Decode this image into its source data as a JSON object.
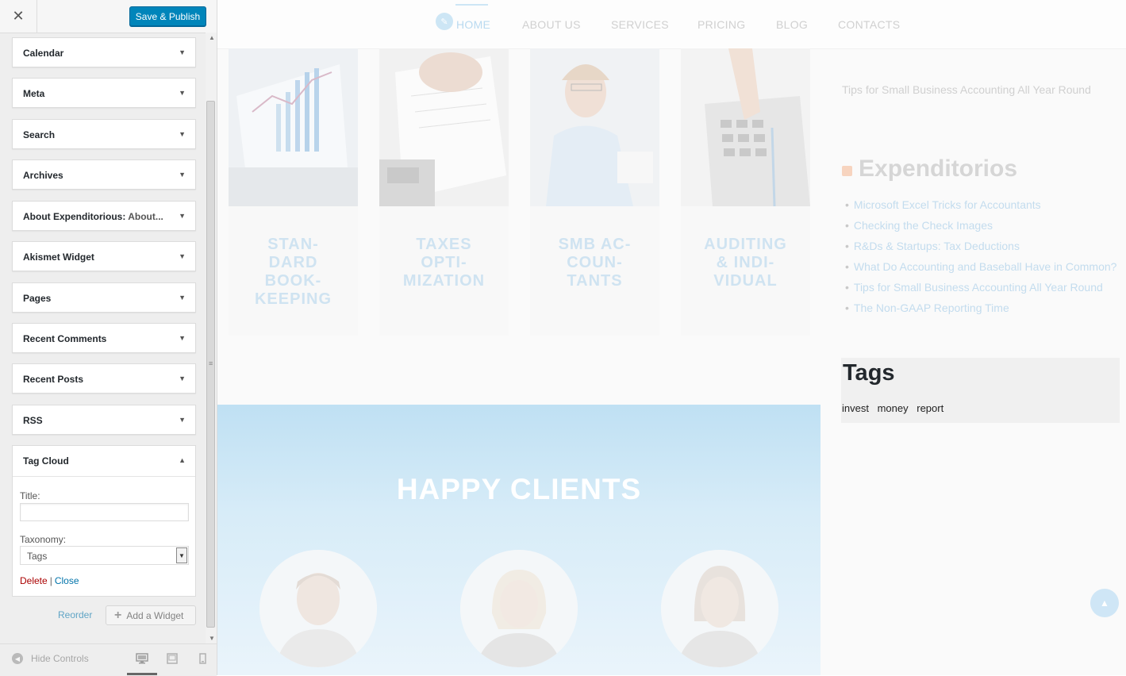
{
  "customizer": {
    "close_label": "✕",
    "publish_label": "Save & Publish",
    "widgets": [
      {
        "title": "Calendar"
      },
      {
        "title": "Meta"
      },
      {
        "title": "Search"
      },
      {
        "title": "Archives"
      },
      {
        "title": "About Expenditorious:",
        "subtitle": "About..."
      },
      {
        "title": "Akismet Widget"
      },
      {
        "title": "Pages"
      },
      {
        "title": "Recent Comments"
      },
      {
        "title": "Recent Posts"
      },
      {
        "title": "RSS"
      }
    ],
    "tag_cloud": {
      "title": "Tag Cloud",
      "title_label": "Title:",
      "title_value": "",
      "taxonomy_label": "Taxonomy:",
      "taxonomy_value": "Tags",
      "delete_label": "Delete",
      "separator": "|",
      "close_label": "Close"
    },
    "reorder_label": "Reorder",
    "add_widget_label": "Add a Widget",
    "hide_controls_label": "Hide Controls"
  },
  "preview": {
    "nav": [
      "HOME",
      "ABOUT US",
      "SERVICES",
      "PRICING",
      "BLOG",
      "CONTACTS"
    ],
    "services": [
      "STAN-\nDARD\nBOOK-\nKEEPING",
      "TAXES\nOPTI-\nMIZATION",
      "SMB AC-\nCOUN-\nTANTS",
      "AUDITING\n& INDI-\nVIDUAL"
    ],
    "sidebar_top_link": "Tips for Small Business Accounting All Year Round",
    "expenditorios_title": "Expenditorios",
    "expenditorios_links": [
      "Microsoft Excel Tricks for Accountants",
      "Checking the Check Images",
      "R&Ds & Startups: Tax Deductions",
      "What Do Accounting and Baseball Have in Common?",
      "Tips for Small Business Accounting All Year Round",
      "The Non-GAAP Reporting Time"
    ],
    "tags_title": "Tags",
    "tags": [
      "invest",
      "money",
      "report"
    ],
    "happy_clients_title": "HAPPY CLIENTS"
  },
  "colors": {
    "publish": "#0085ba",
    "link": "#0073aa",
    "delete": "#aa0000"
  },
  "icons": [
    "close-icon",
    "caret-down-icon",
    "caret-up-icon",
    "plus-icon",
    "hide-controls-icon",
    "desktop-icon",
    "tablet-icon",
    "mobile-icon",
    "home-icon",
    "rss-icon",
    "scroll-top-icon"
  ]
}
